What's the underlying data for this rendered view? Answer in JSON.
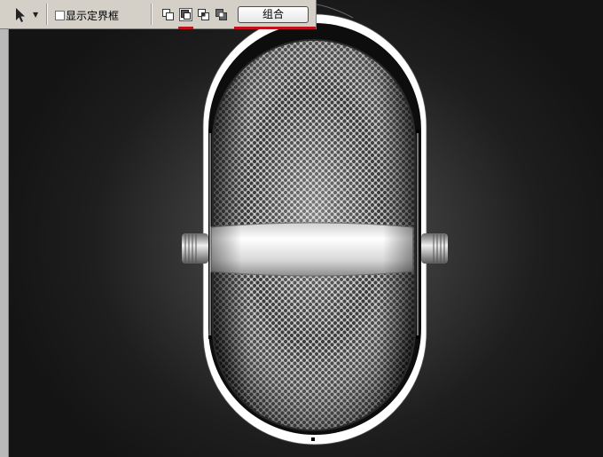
{
  "toolbar": {
    "select_tool_icon": "arrow-pointer-icon",
    "select_tool_dropdown_icon": "triangle-down-icon",
    "show_bounding_box_checked": false,
    "show_bounding_box_label": "显示定界框",
    "path_modes": [
      {
        "name": "add-to-shape-area-icon"
      },
      {
        "name": "subtract-from-shape-area-icon",
        "selected": true
      },
      {
        "name": "intersect-shape-areas-icon"
      },
      {
        "name": "exclude-overlapping-shape-areas-icon"
      }
    ],
    "combine_label": "组合",
    "highlight_color": "#c0121b"
  },
  "canvas": {
    "background_color": "#1e1e1e",
    "subject": "microphone-icon"
  }
}
